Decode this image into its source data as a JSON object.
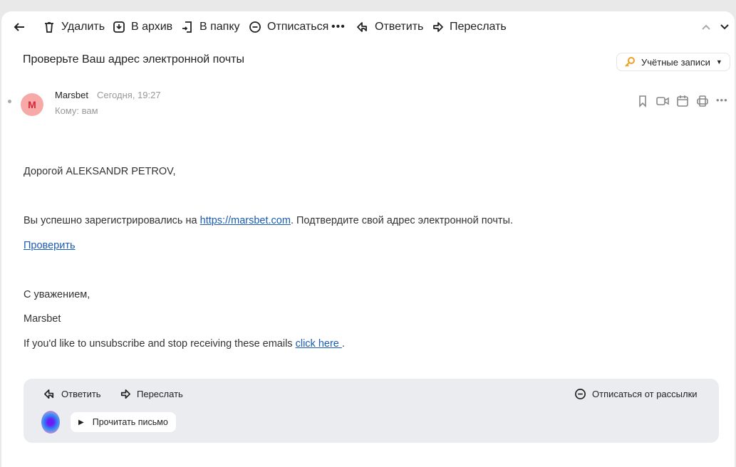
{
  "toolbar": {
    "delete": "Удалить",
    "archive": "В архив",
    "folder": "В папку",
    "unsubscribe": "Отписаться",
    "reply": "Ответить",
    "forward": "Переслать"
  },
  "subject": "Проверьте Ваш адрес электронной почты",
  "accounts": "Учётные записи",
  "message": {
    "avatar_letter": "M",
    "sender": "Marsbet",
    "date": "Сегодня, 19:27",
    "to": "Кому: вам"
  },
  "body": {
    "greeting": "Дорогой ALEKSANDR PETROV,",
    "line1_pre": "Вы успешно зарегистрировались на ",
    "line1_link": "https://marsbet.com",
    "line1_post": ". Подтвердите свой адрес электронной почты.",
    "verify": "Проверить",
    "regards": "С уважением,",
    "signature": "Marsbet",
    "unsub_pre": "If you'd like to unsubscribe and stop receiving these emails ",
    "unsub_link": "click here ",
    "unsub_post": "."
  },
  "footer": {
    "reply": "Ответить",
    "forward": "Переслать",
    "unsubscribe": "Отписаться от рассылки",
    "read": "Прочитать письмо"
  },
  "colors": {
    "accent": "#f0a020",
    "link": "#1a5bb5"
  }
}
